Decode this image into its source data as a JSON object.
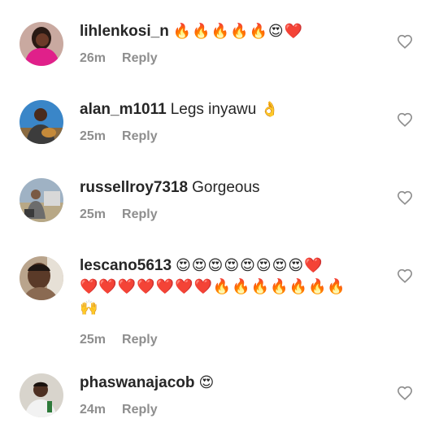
{
  "comments": [
    {
      "username": "lihlenkosi_n",
      "text": "",
      "emoji": "🔥🔥🔥🔥🔥😍❤️",
      "emoji_line2": "",
      "time": "26m",
      "reply_label": "Reply",
      "avatar_icon": "avatar-woman-pink-top",
      "avatar_colors": {
        "bg": "#c9a9a0",
        "main": "#e0208a",
        "skin": "#6b3a28",
        "hair": "#2a1a14"
      }
    },
    {
      "username": "alan_m1011",
      "text": "Legs inyawu",
      "emoji": "👌",
      "emoji_line2": "",
      "time": "25m",
      "reply_label": "Reply",
      "avatar_icon": "avatar-man-blue-background",
      "avatar_colors": {
        "bg": "#3a86c8",
        "main": "#3c3c3c",
        "skin": "#4a2b1c",
        "hair": "#1c140f"
      }
    },
    {
      "username": "russellroy7318",
      "text": "Gorgeous",
      "emoji": "",
      "emoji_line2": "",
      "time": "25m",
      "reply_label": "Reply",
      "avatar_icon": "avatar-outdoor-photo",
      "avatar_colors": {
        "bg": "#9fb2c4",
        "main": "#6c6c6c",
        "skin": "#7a5a44",
        "hair": "#3a3a3a"
      }
    },
    {
      "username": "lescano5613",
      "text": "",
      "emoji": "😍😍😍😍😍😍😍😍❤️",
      "emoji_line2": "❤️❤️❤️❤️❤️❤️❤️🔥🔥🔥🔥🔥🔥🔥",
      "emoji_line3": "🙌",
      "time": "25m",
      "reply_label": "Reply",
      "avatar_icon": "avatar-man-selfie",
      "avatar_colors": {
        "bg": "#b9a48c",
        "main": "#8a6a52",
        "skin": "#5a3a28",
        "hair": "#1e1612"
      }
    },
    {
      "username": "phaswanajacob",
      "text": "",
      "emoji": "😍",
      "emoji_line2": "",
      "time": "24m",
      "reply_label": "Reply",
      "avatar_icon": "avatar-man-white-shirt",
      "avatar_colors": {
        "bg": "#d8d4cc",
        "main": "#f2f2f2",
        "skin": "#4e3022",
        "hair": "#1a120e"
      }
    }
  ],
  "like_icon": "heart-outline-icon",
  "colors": {
    "meta": "#8e8e8e",
    "text": "#262626",
    "heart": "#8e8e8e"
  }
}
